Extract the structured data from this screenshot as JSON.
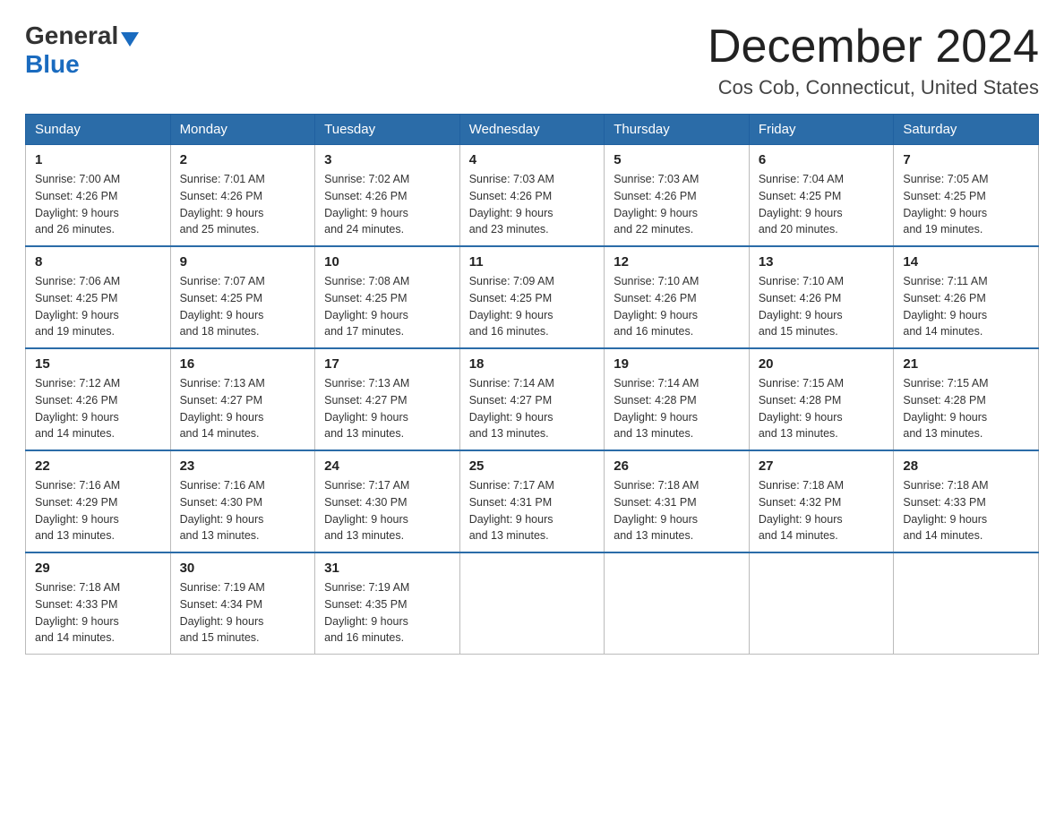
{
  "header": {
    "logo_general": "General",
    "logo_blue": "Blue",
    "month": "December 2024",
    "location": "Cos Cob, Connecticut, United States"
  },
  "days_of_week": [
    "Sunday",
    "Monday",
    "Tuesday",
    "Wednesday",
    "Thursday",
    "Friday",
    "Saturday"
  ],
  "weeks": [
    [
      {
        "day": "1",
        "sunrise": "7:00 AM",
        "sunset": "4:26 PM",
        "daylight": "9 hours and 26 minutes."
      },
      {
        "day": "2",
        "sunrise": "7:01 AM",
        "sunset": "4:26 PM",
        "daylight": "9 hours and 25 minutes."
      },
      {
        "day": "3",
        "sunrise": "7:02 AM",
        "sunset": "4:26 PM",
        "daylight": "9 hours and 24 minutes."
      },
      {
        "day": "4",
        "sunrise": "7:03 AM",
        "sunset": "4:26 PM",
        "daylight": "9 hours and 23 minutes."
      },
      {
        "day": "5",
        "sunrise": "7:03 AM",
        "sunset": "4:26 PM",
        "daylight": "9 hours and 22 minutes."
      },
      {
        "day": "6",
        "sunrise": "7:04 AM",
        "sunset": "4:25 PM",
        "daylight": "9 hours and 20 minutes."
      },
      {
        "day": "7",
        "sunrise": "7:05 AM",
        "sunset": "4:25 PM",
        "daylight": "9 hours and 19 minutes."
      }
    ],
    [
      {
        "day": "8",
        "sunrise": "7:06 AM",
        "sunset": "4:25 PM",
        "daylight": "9 hours and 19 minutes."
      },
      {
        "day": "9",
        "sunrise": "7:07 AM",
        "sunset": "4:25 PM",
        "daylight": "9 hours and 18 minutes."
      },
      {
        "day": "10",
        "sunrise": "7:08 AM",
        "sunset": "4:25 PM",
        "daylight": "9 hours and 17 minutes."
      },
      {
        "day": "11",
        "sunrise": "7:09 AM",
        "sunset": "4:25 PM",
        "daylight": "9 hours and 16 minutes."
      },
      {
        "day": "12",
        "sunrise": "7:10 AM",
        "sunset": "4:26 PM",
        "daylight": "9 hours and 16 minutes."
      },
      {
        "day": "13",
        "sunrise": "7:10 AM",
        "sunset": "4:26 PM",
        "daylight": "9 hours and 15 minutes."
      },
      {
        "day": "14",
        "sunrise": "7:11 AM",
        "sunset": "4:26 PM",
        "daylight": "9 hours and 14 minutes."
      }
    ],
    [
      {
        "day": "15",
        "sunrise": "7:12 AM",
        "sunset": "4:26 PM",
        "daylight": "9 hours and 14 minutes."
      },
      {
        "day": "16",
        "sunrise": "7:13 AM",
        "sunset": "4:27 PM",
        "daylight": "9 hours and 14 minutes."
      },
      {
        "day": "17",
        "sunrise": "7:13 AM",
        "sunset": "4:27 PM",
        "daylight": "9 hours and 13 minutes."
      },
      {
        "day": "18",
        "sunrise": "7:14 AM",
        "sunset": "4:27 PM",
        "daylight": "9 hours and 13 minutes."
      },
      {
        "day": "19",
        "sunrise": "7:14 AM",
        "sunset": "4:28 PM",
        "daylight": "9 hours and 13 minutes."
      },
      {
        "day": "20",
        "sunrise": "7:15 AM",
        "sunset": "4:28 PM",
        "daylight": "9 hours and 13 minutes."
      },
      {
        "day": "21",
        "sunrise": "7:15 AM",
        "sunset": "4:28 PM",
        "daylight": "9 hours and 13 minutes."
      }
    ],
    [
      {
        "day": "22",
        "sunrise": "7:16 AM",
        "sunset": "4:29 PM",
        "daylight": "9 hours and 13 minutes."
      },
      {
        "day": "23",
        "sunrise": "7:16 AM",
        "sunset": "4:30 PM",
        "daylight": "9 hours and 13 minutes."
      },
      {
        "day": "24",
        "sunrise": "7:17 AM",
        "sunset": "4:30 PM",
        "daylight": "9 hours and 13 minutes."
      },
      {
        "day": "25",
        "sunrise": "7:17 AM",
        "sunset": "4:31 PM",
        "daylight": "9 hours and 13 minutes."
      },
      {
        "day": "26",
        "sunrise": "7:18 AM",
        "sunset": "4:31 PM",
        "daylight": "9 hours and 13 minutes."
      },
      {
        "day": "27",
        "sunrise": "7:18 AM",
        "sunset": "4:32 PM",
        "daylight": "9 hours and 14 minutes."
      },
      {
        "day": "28",
        "sunrise": "7:18 AM",
        "sunset": "4:33 PM",
        "daylight": "9 hours and 14 minutes."
      }
    ],
    [
      {
        "day": "29",
        "sunrise": "7:18 AM",
        "sunset": "4:33 PM",
        "daylight": "9 hours and 14 minutes."
      },
      {
        "day": "30",
        "sunrise": "7:19 AM",
        "sunset": "4:34 PM",
        "daylight": "9 hours and 15 minutes."
      },
      {
        "day": "31",
        "sunrise": "7:19 AM",
        "sunset": "4:35 PM",
        "daylight": "9 hours and 16 minutes."
      },
      null,
      null,
      null,
      null
    ]
  ],
  "labels": {
    "sunrise": "Sunrise:",
    "sunset": "Sunset:",
    "daylight": "Daylight:"
  }
}
